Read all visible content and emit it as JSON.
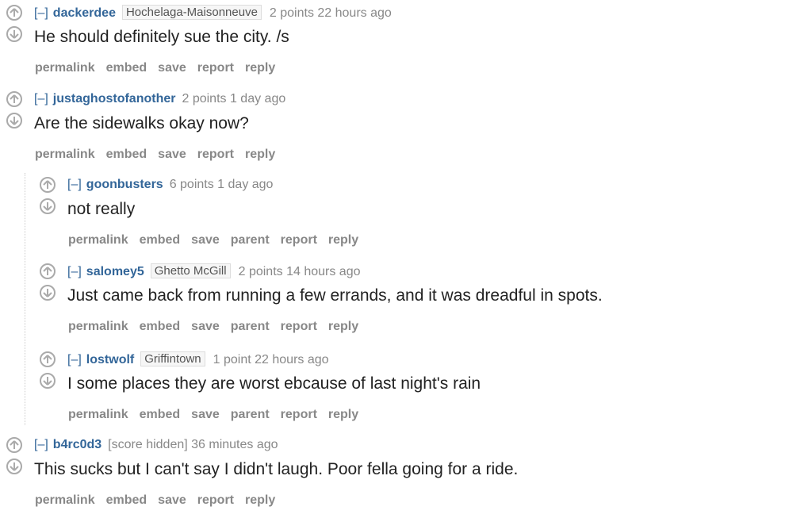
{
  "comments": [
    {
      "collapse": "[–]",
      "author": "dackerdee",
      "flair": "Hochelaga-Maisonneuve",
      "score": "2 points 22 hours ago",
      "body": "He should definitely sue the city. /s",
      "buttons": [
        "permalink",
        "embed",
        "save",
        "report",
        "reply"
      ]
    },
    {
      "collapse": "[–]",
      "author": "justaghostofanother",
      "flair": "",
      "score": "2 points 1 day ago",
      "body": "Are the sidewalks okay now?",
      "buttons": [
        "permalink",
        "embed",
        "save",
        "report",
        "reply"
      ]
    },
    {
      "collapse": "[–]",
      "author": "goonbusters",
      "flair": "",
      "score": "6 points 1 day ago",
      "body": "not really",
      "buttons": [
        "permalink",
        "embed",
        "save",
        "parent",
        "report",
        "reply"
      ]
    },
    {
      "collapse": "[–]",
      "author": "salomey5",
      "flair": "Ghetto McGill",
      "score": "2 points 14 hours ago",
      "body": "Just came back from running a few errands, and it was dreadful in spots.",
      "buttons": [
        "permalink",
        "embed",
        "save",
        "parent",
        "report",
        "reply"
      ]
    },
    {
      "collapse": "[–]",
      "author": "lostwolf",
      "flair": "Griffintown",
      "score": "1 point 22 hours ago",
      "body": "I some places they are worst ebcause of last night's rain",
      "buttons": [
        "permalink",
        "embed",
        "save",
        "parent",
        "report",
        "reply"
      ]
    },
    {
      "collapse": "[–]",
      "author": "b4rc0d3",
      "flair": "",
      "score": "[score hidden] 36 minutes ago",
      "body": "This sucks but I can't say I didn't laugh. Poor fella going for a ride.",
      "buttons": [
        "permalink",
        "embed",
        "save",
        "report",
        "reply"
      ]
    }
  ],
  "icons": {
    "upvote": "upvote-arrow-icon",
    "downvote": "downvote-arrow-icon"
  }
}
